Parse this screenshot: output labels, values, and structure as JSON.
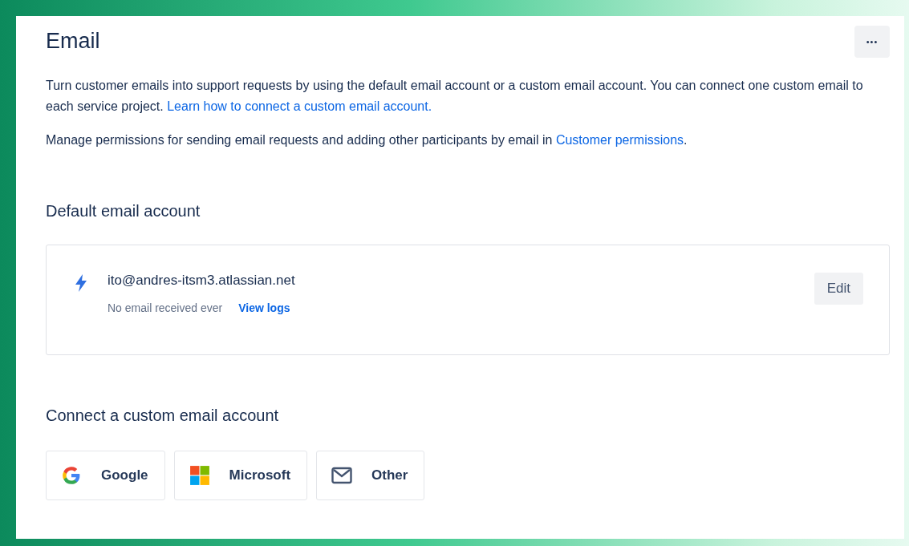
{
  "page": {
    "title": "Email",
    "more_button": "•••"
  },
  "intro": [
    {
      "text": "Turn customer emails into support requests by using the default email account or a custom email account. You can connect one custom email to each service project.",
      "link": "Learn how to connect a custom email account."
    },
    {
      "text": "Manage permissions for sending email requests and adding other participants by email in",
      "link": "Customer permissions",
      "after": "."
    }
  ],
  "default_account": {
    "heading": "Default email account",
    "address": "ito@andres-itsm3.atlassian.net",
    "status": "No email received ever",
    "logs_link": "View logs",
    "edit_button": "Edit"
  },
  "custom_account": {
    "heading": "Connect a custom email account",
    "providers": [
      {
        "kind": "google",
        "label": "Google"
      },
      {
        "kind": "microsoft",
        "label": "Microsoft"
      },
      {
        "kind": "other",
        "label": "Other"
      }
    ]
  }
}
